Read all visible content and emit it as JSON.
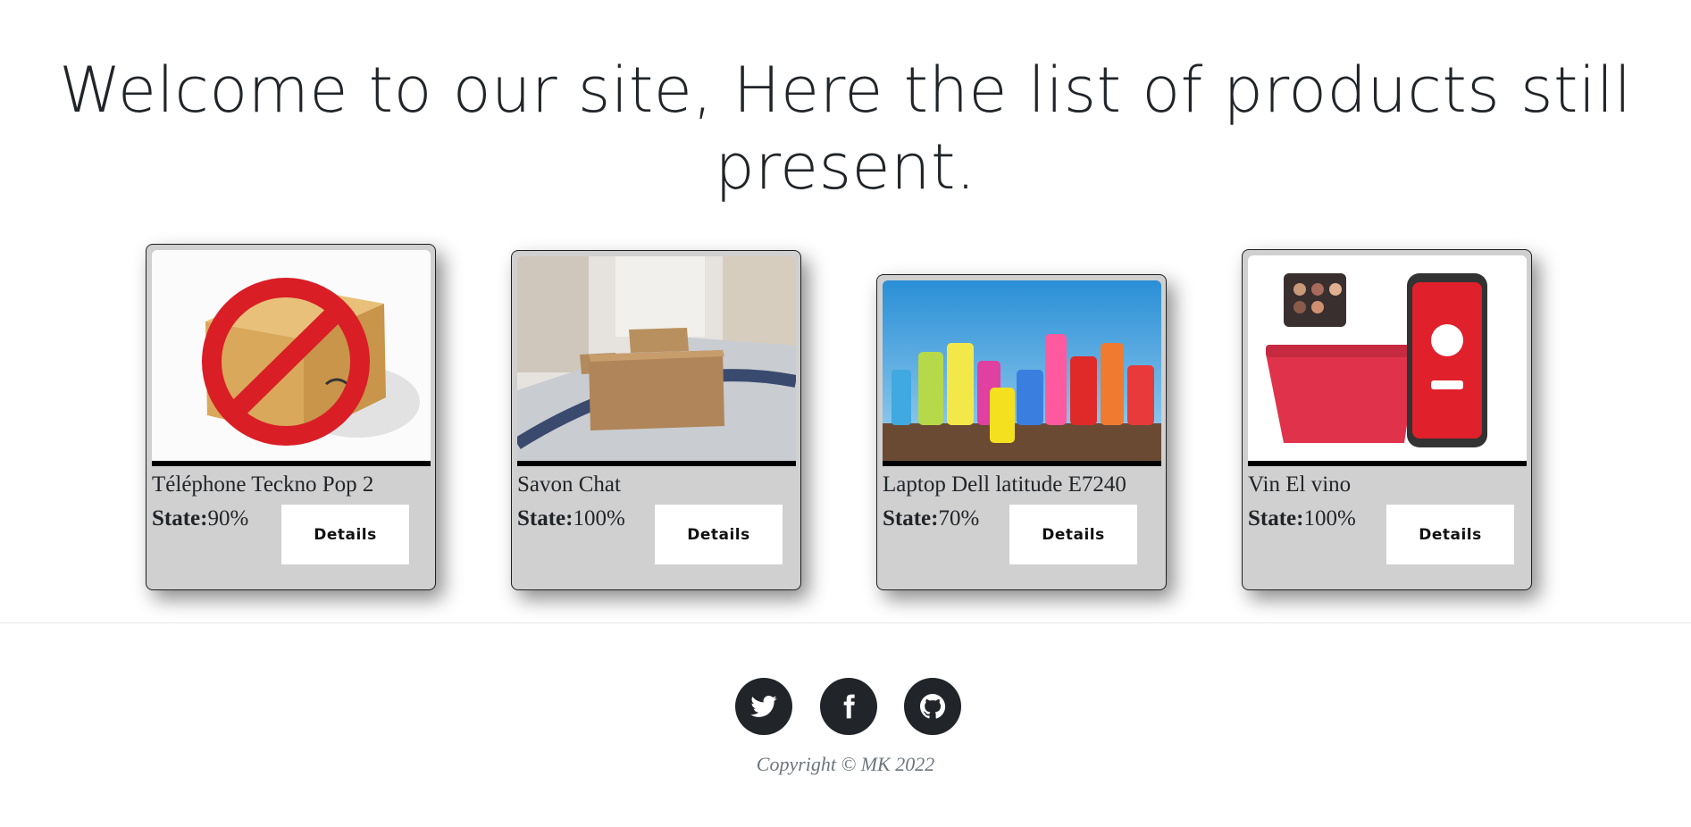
{
  "hero": {
    "title": "Welcome to our site, Here the list of products still present."
  },
  "products": [
    {
      "name": "Téléphone Teckno Pop 2",
      "state_label": "State:",
      "state_value": "90%",
      "details_label": "Details",
      "image": "no-box-icon"
    },
    {
      "name": "Savon Chat",
      "state_label": "State:",
      "state_value": "100%",
      "details_label": "Details",
      "image": "boxes-on-conveyor-photo"
    },
    {
      "name": "Laptop Dell latitude E7240",
      "state_label": "State:",
      "state_value": "70%",
      "details_label": "Details",
      "image": "cleaning-bottles-photo"
    },
    {
      "name": "Vin El vino",
      "state_label": "State:",
      "state_value": "100%",
      "details_label": "Details",
      "image": "shopping-basket-phone-photo"
    }
  ],
  "footer": {
    "social": [
      "twitter-icon",
      "facebook-icon",
      "github-icon"
    ],
    "copyright": "Copyright © MK 2022"
  },
  "colors": {
    "card_background": "#d0d0d0",
    "dark": "#212529",
    "muted": "#6c757d"
  }
}
